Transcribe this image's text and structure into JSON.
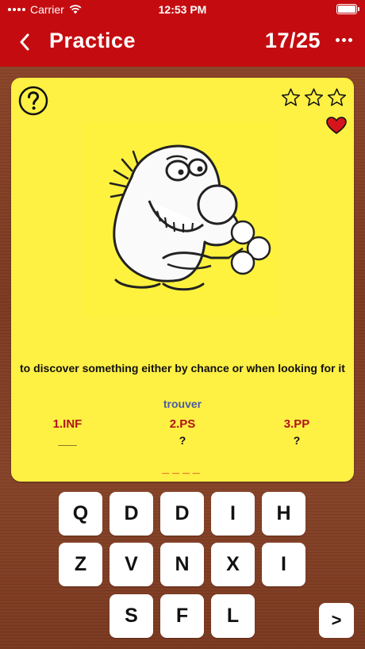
{
  "status_bar": {
    "carrier": "Carrier",
    "time": "12:53 PM"
  },
  "nav": {
    "title": "Practice",
    "progress": "17/25"
  },
  "card": {
    "definition": "to discover something either by chance or when looking for it",
    "verb": "trouver",
    "forms": [
      {
        "label": "1.INF",
        "value": "___"
      },
      {
        "label": "2.PS",
        "value": "?"
      },
      {
        "label": "3.PP",
        "value": "?"
      }
    ],
    "answer_slots": "____",
    "rating": {
      "filled": 0,
      "total": 3
    },
    "favorite": true
  },
  "keyboard": {
    "row1": [
      "Q",
      "D",
      "D",
      "I",
      "H"
    ],
    "row2": [
      "Z",
      "V",
      "N",
      "X",
      "I"
    ],
    "row3": [
      "S",
      "F",
      "L"
    ],
    "next": ">"
  },
  "colors": {
    "accent": "#c40c10",
    "card": "#fff044",
    "label_red": "#b0141a",
    "verb_blue": "#4a5ba3"
  }
}
